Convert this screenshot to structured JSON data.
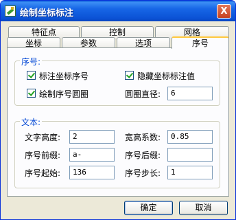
{
  "window": {
    "title": "绘制坐标标注",
    "close_glyph": "X"
  },
  "tabs": {
    "row_back": [
      "特征点",
      "控制",
      "网格"
    ],
    "row_front": [
      "坐标",
      "参数",
      "选项",
      "序号"
    ],
    "active": "序号"
  },
  "group_number": {
    "title": "序号:",
    "cb_label_coord_number": "标注坐标序号",
    "cb_hide_coord_value": "隐藏坐标标注值",
    "cb_draw_number_circle": "绘制序号圆圈",
    "circle_diameter_label": "圆圈直径:",
    "circle_diameter_value": "6"
  },
  "group_text": {
    "title": "文本:",
    "text_height_label": "文字高度:",
    "text_height_value": "2",
    "width_ratio_label": "宽高系数:",
    "width_ratio_value": "0.85",
    "prefix_label": "序号前缀:",
    "prefix_value": "a-",
    "suffix_label": "序号后缀:",
    "suffix_value": "",
    "start_label": "序号起始:",
    "start_value": "136",
    "step_label": "序号步长:",
    "step_value": "1"
  },
  "buttons": {
    "ok": "确定",
    "cancel": "取消"
  }
}
